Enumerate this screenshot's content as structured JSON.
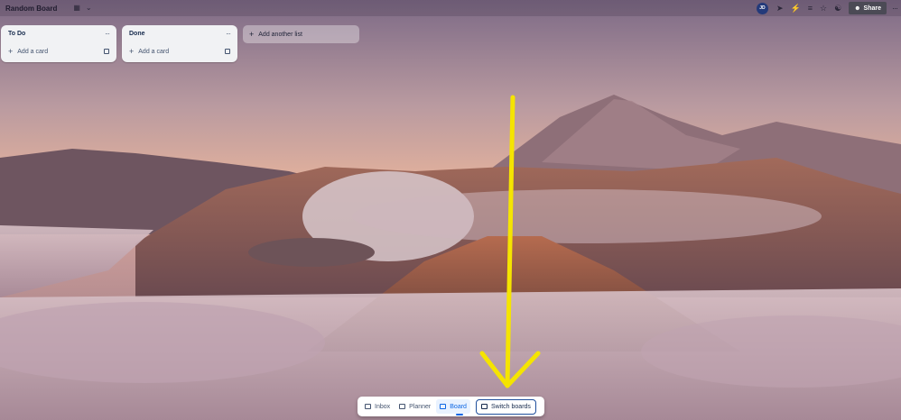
{
  "header": {
    "board_title": "Random Board",
    "view_icon": "board-view-icon",
    "chevron_icon": "chevron-down-icon",
    "avatar_initials": "JD",
    "share_label": "Share",
    "icons": [
      "rocket-icon",
      "lightning-icon",
      "filter-icon",
      "star-icon",
      "team-icon",
      "more-icon"
    ]
  },
  "lists": [
    {
      "title": "To Do",
      "add_card_label": "Add a card"
    },
    {
      "title": "Done",
      "add_card_label": "Add a card"
    }
  ],
  "add_list_label": "Add another list",
  "switcher": {
    "inbox_label": "Inbox",
    "planner_label": "Planner",
    "board_label": "Board",
    "switch_label": "Switch boards",
    "active": "Board"
  },
  "colors": {
    "accent": "#0c66e4",
    "annotation_arrow": "#f5e400",
    "list_bg": "#f1f2f4"
  }
}
